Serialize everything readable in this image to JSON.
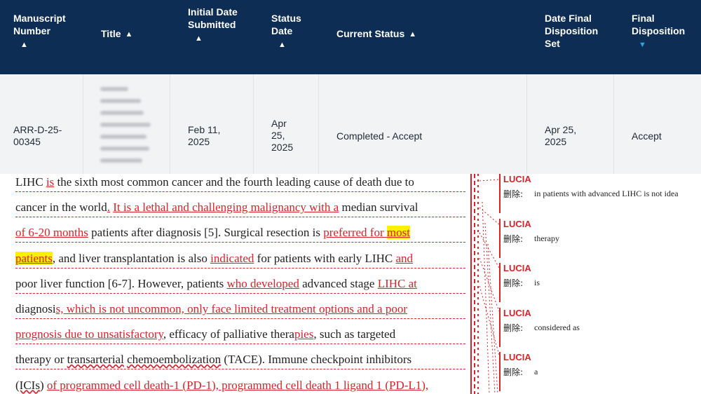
{
  "table": {
    "headers": [
      {
        "label": "Manuscript Number",
        "sort": "up"
      },
      {
        "label": "Title",
        "sort": "up"
      },
      {
        "label": "Initial Date Submitted",
        "sort": "up"
      },
      {
        "label": "Status Date",
        "sort": "up"
      },
      {
        "label": "Current Status",
        "sort": "up"
      },
      {
        "label": "Date Final Disposition Set",
        "sort": "up"
      },
      {
        "label": "Final Disposition",
        "sort": "down-active"
      }
    ],
    "row": {
      "manuscript_number": "ARR-D-25-00345",
      "title_blurred": true,
      "initial_date_submitted": "Feb 11, 2025",
      "status_date": "Apr 25, 2025",
      "current_status": "Completed - Accept",
      "date_final_disposition_set": "Apr 25, 2025",
      "final_disposition": "Accept"
    },
    "colors": {
      "header_bg": "#0d2d55",
      "row_bg": "#f2f3f5",
      "active_sort": "#2aa6e0"
    }
  },
  "document": {
    "lines": [
      [
        {
          "t": "LIHC "
        },
        {
          "t": "is",
          "c": "ins"
        },
        {
          "t": " the sixth most common cancer and the fourth leading cause of death due to"
        }
      ],
      [
        {
          "t": "cancer in the world"
        },
        {
          "t": ".",
          "c": "ins"
        },
        {
          "t": " "
        },
        {
          "t": "It is a lethal and challenging malignancy with a",
          "c": "ins"
        },
        {
          "t": " median survival"
        }
      ],
      [
        {
          "t": "of ",
          "c": "ins"
        },
        {
          "t": "6-20 months",
          "c": "ins"
        },
        {
          "t": " patients after diagnosis [5]. Surgical resection is "
        },
        {
          "t": "preferred for ",
          "c": "ins"
        },
        {
          "t": "most",
          "c": "hl"
        }
      ],
      [
        {
          "t": "patients",
          "c": "hl"
        },
        {
          "t": ", and liver transplantation is also "
        },
        {
          "t": "indicated",
          "c": "ins"
        },
        {
          "t": " for patients with early LIHC "
        },
        {
          "t": "and",
          "c": "ins"
        }
      ],
      [
        {
          "t": "poor liver function [6-7]. However, patients "
        },
        {
          "t": "who developed",
          "c": "ins"
        },
        {
          "t": " advanced stage "
        },
        {
          "t": "LIHC at",
          "c": "ins"
        }
      ],
      [
        {
          "t": "diagnosi"
        },
        {
          "t": "s, which is not uncommon, only face limited treatment options and a poor",
          "c": "ins"
        }
      ],
      [
        {
          "t": "prognosis due to unsatisfactory",
          "c": "ins"
        },
        {
          "t": ", efficacy of palliative thera"
        },
        {
          "t": "pies",
          "c": "ins"
        },
        {
          "t": ", such as targeted"
        }
      ],
      [
        {
          "t": "therapy or "
        },
        {
          "t": "transarterial",
          "c": "sq"
        },
        {
          "t": " "
        },
        {
          "t": "chemoembolization",
          "c": "sq"
        },
        {
          "t": " (TACE). Immune checkpoint inhibitors"
        }
      ],
      [
        {
          "t": "(ICIs",
          "c": "sq"
        },
        {
          "t": ") "
        },
        {
          "t": "of programmed cell death-1 (PD-1), programmed cell death 1 ligand 1 (PD-L1),",
          "c": "ins"
        }
      ]
    ],
    "colors": {
      "insert": "#d8232a",
      "highlight": "#ffef00"
    }
  },
  "comments": [
    {
      "author": "LUCIA",
      "kind": "删除:",
      "text": "in patients with advanced LIHC is not idea"
    },
    {
      "author": "LUCIA",
      "kind": "删除:",
      "text": "therapy"
    },
    {
      "author": "LUCIA",
      "kind": "删除:",
      "text": "is"
    },
    {
      "author": "LUCIA",
      "kind": "删除:",
      "text": "considered as"
    },
    {
      "author": "LUCIA",
      "kind": "删除:",
      "text": "a"
    }
  ]
}
